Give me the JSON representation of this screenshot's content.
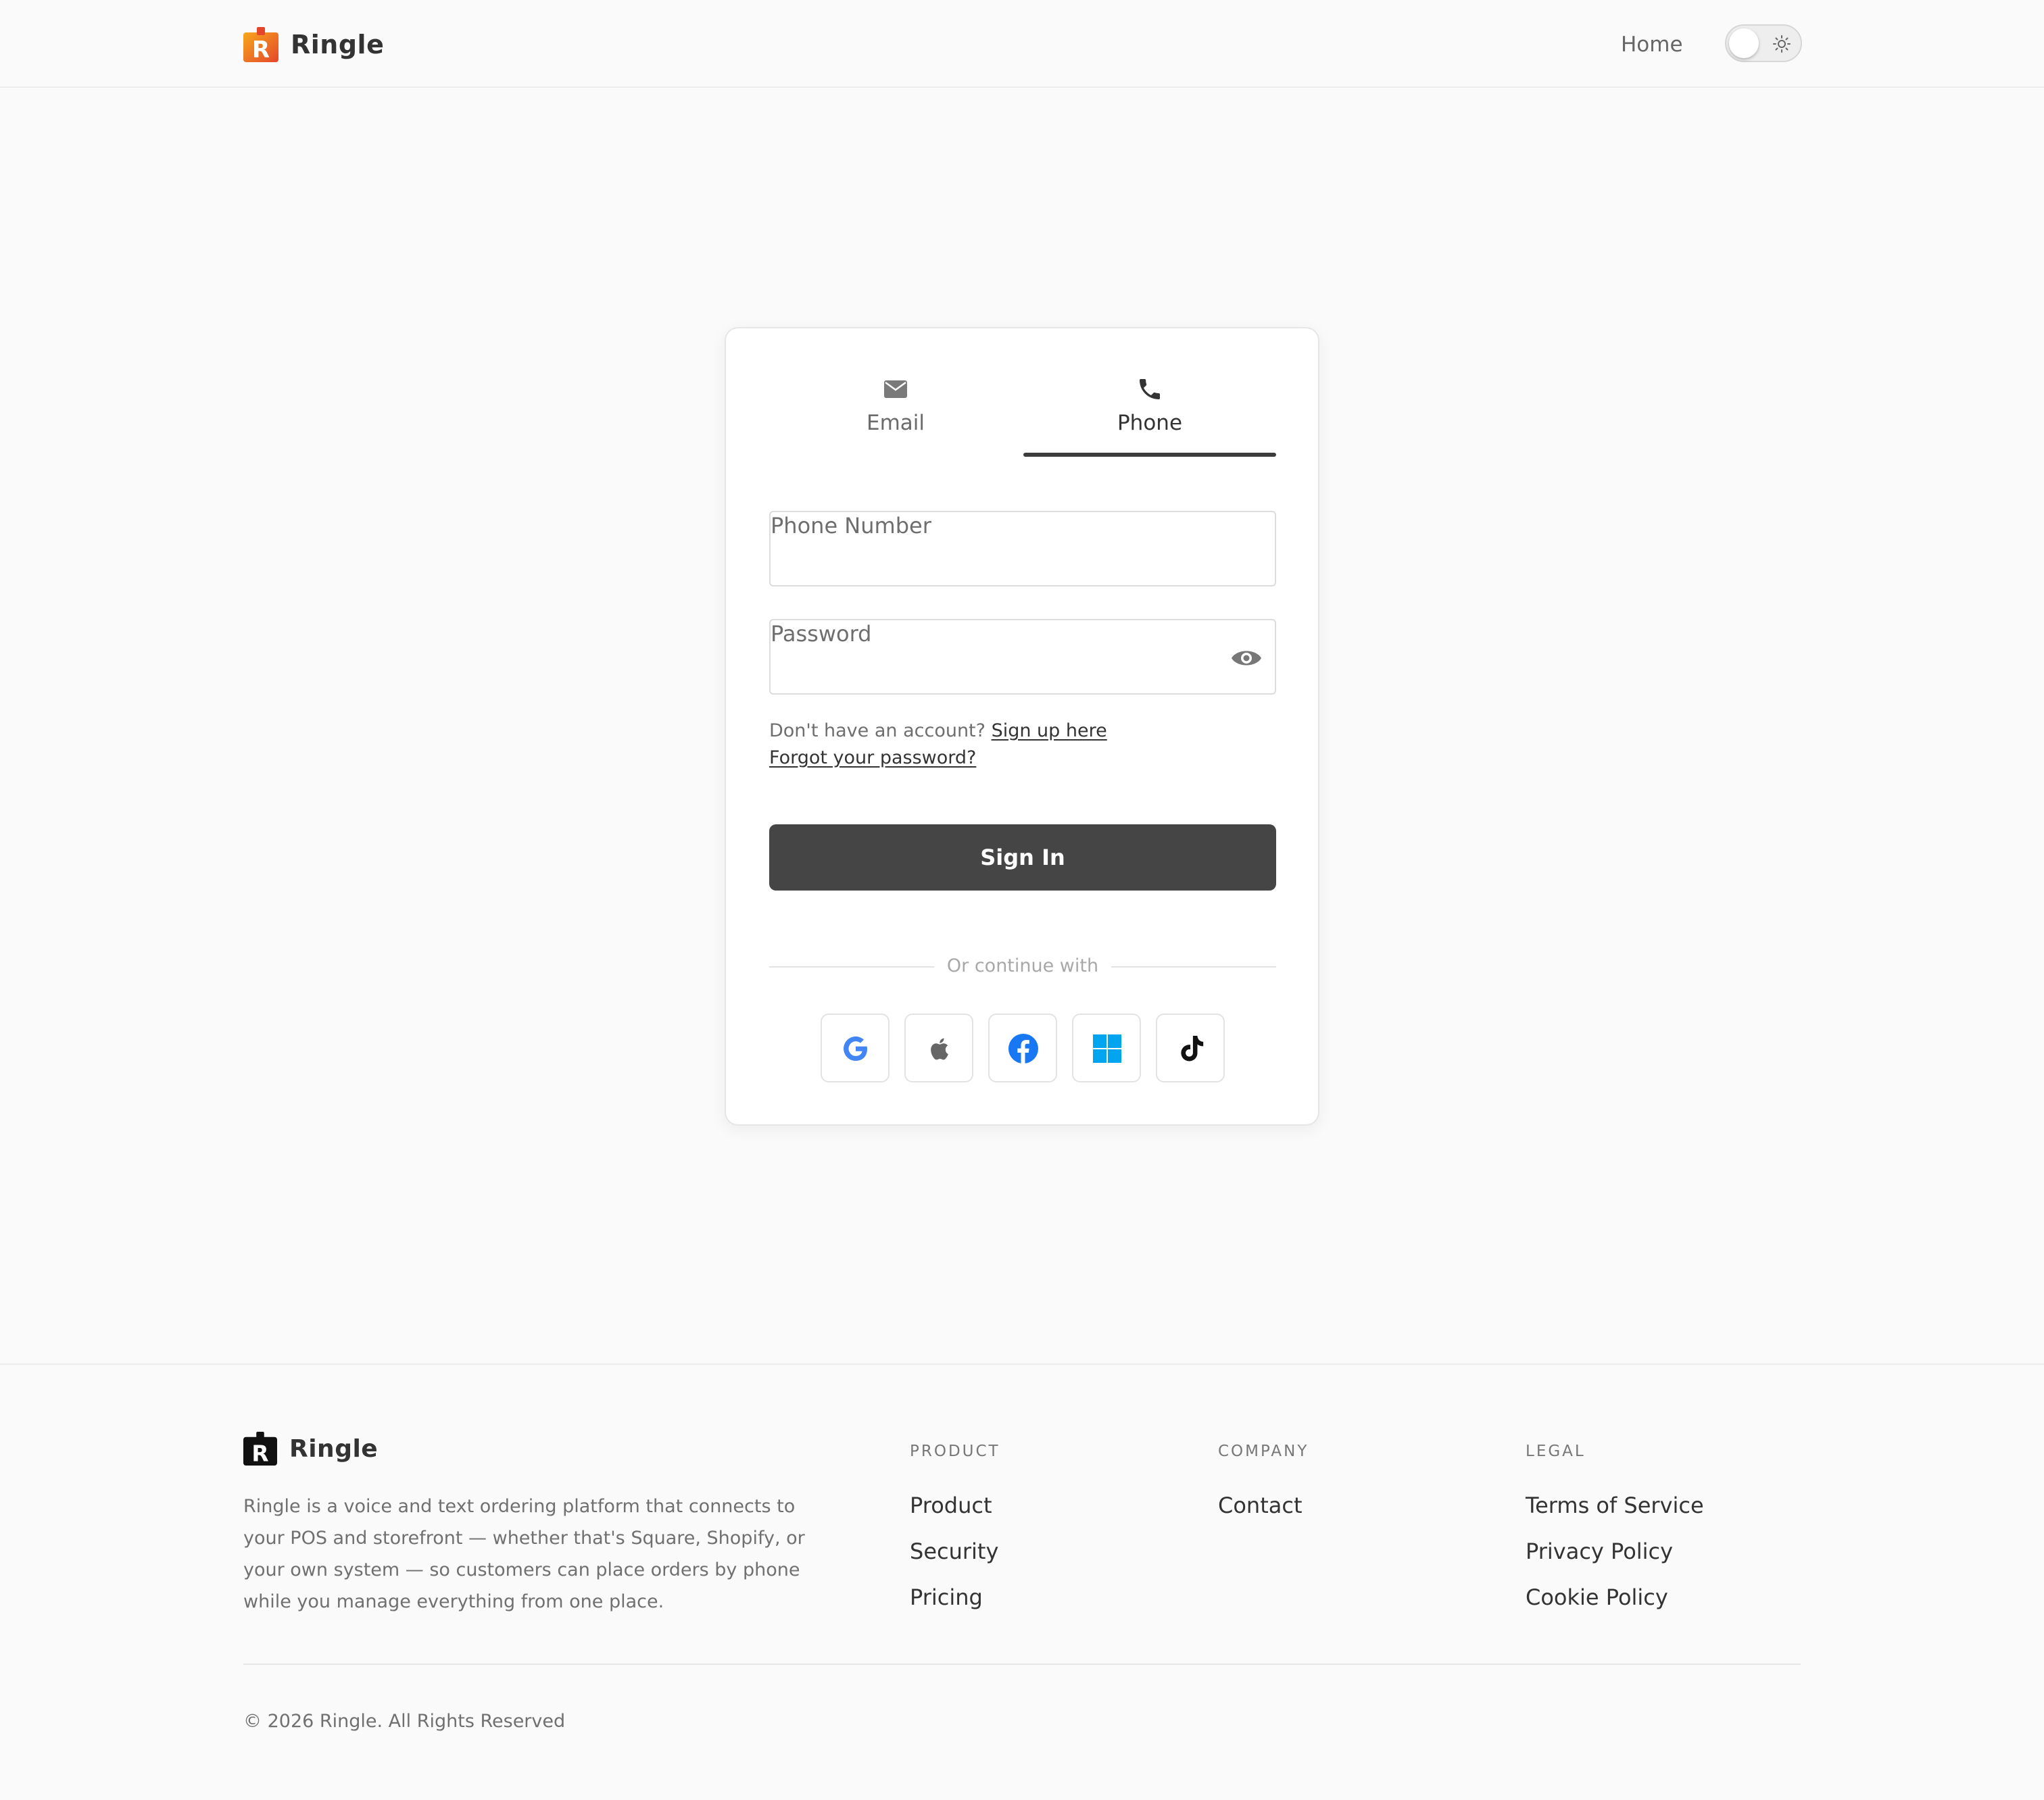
{
  "header": {
    "brand": "Ringle",
    "nav_home": "Home"
  },
  "tabs": {
    "email": "Email",
    "phone": "Phone",
    "active": "phone"
  },
  "form": {
    "phone_label": "Phone Number",
    "phone_value": "",
    "password_label": "Password",
    "password_value": "",
    "no_account": "Don't have an account?",
    "signup_link": "Sign up here",
    "forgot_link": "Forgot your password?",
    "signin_button": "Sign In",
    "divider": "Or continue with"
  },
  "social": [
    {
      "name": "google",
      "icon": "google-icon"
    },
    {
      "name": "apple",
      "icon": "apple-icon"
    },
    {
      "name": "facebook",
      "icon": "facebook-icon"
    },
    {
      "name": "windows",
      "icon": "windows-icon"
    },
    {
      "name": "tiktok",
      "icon": "tiktok-icon"
    }
  ],
  "footer": {
    "brand": "Ringle",
    "description": "Ringle is a voice and text ordering platform that connects to your POS and storefront — whether that's Square, Shopify, or your own system — so customers can place orders by phone while you manage everything from one place.",
    "columns": [
      {
        "heading": "PRODUCT",
        "links": [
          "Product",
          "Security",
          "Pricing"
        ]
      },
      {
        "heading": "COMPANY",
        "links": [
          "Contact"
        ]
      },
      {
        "heading": "LEGAL",
        "links": [
          "Terms of Service",
          "Privacy Policy",
          "Cookie Policy"
        ]
      }
    ],
    "copyright": "© 2026 Ringle. All Rights Reserved"
  },
  "colors": {
    "brand_orange": "#f28a1e",
    "brand_red": "#e5462b",
    "button_dark": "#454545",
    "google_blue": "#4285f4",
    "facebook_blue": "#1877f2",
    "windows_blue": "#00a4ef"
  }
}
